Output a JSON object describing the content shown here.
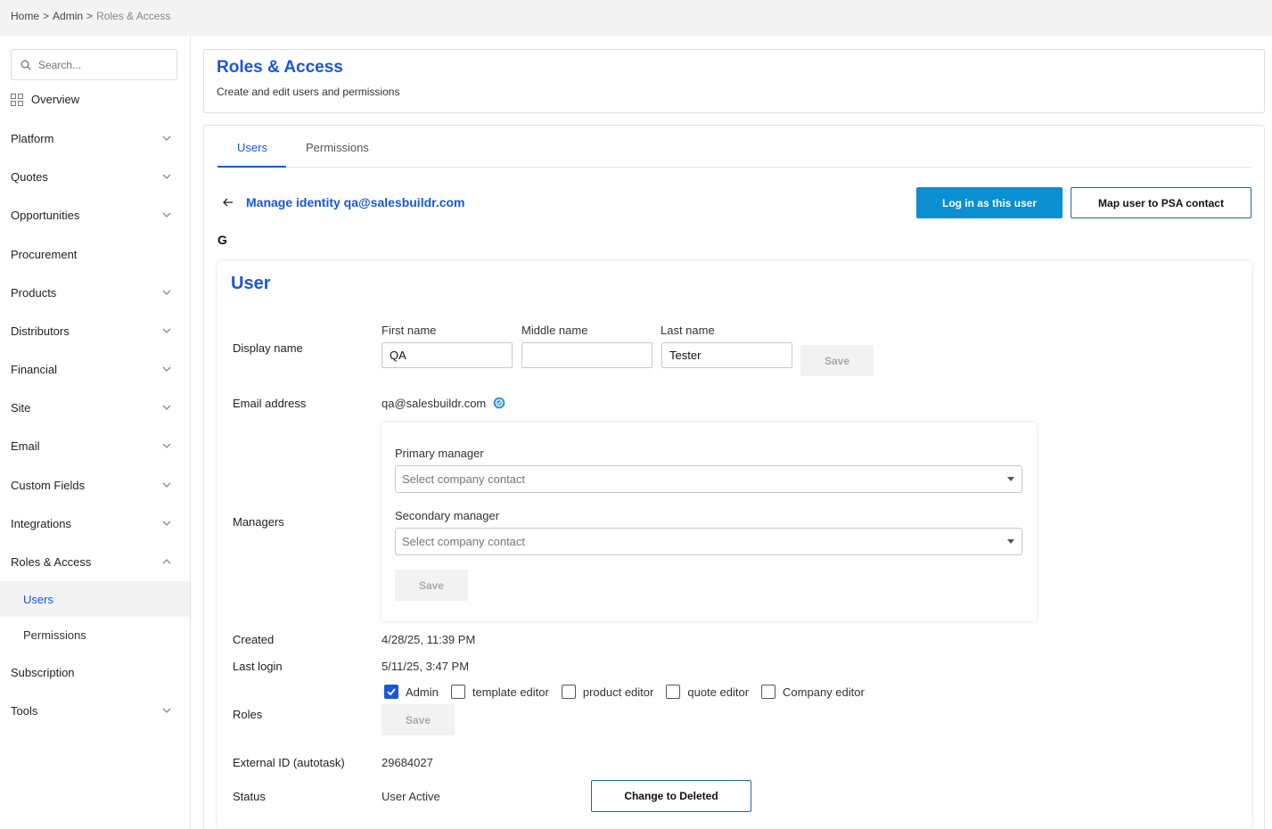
{
  "breadcrumb": {
    "home": "Home",
    "sep1": ">",
    "admin": "Admin",
    "sep2": ">",
    "current": "Roles & Access"
  },
  "sidebar": {
    "search_placeholder": "Search...",
    "overview": "Overview",
    "items": [
      {
        "label": "Platform"
      },
      {
        "label": "Quotes"
      },
      {
        "label": "Opportunities"
      },
      {
        "label": "Procurement"
      },
      {
        "label": "Products"
      },
      {
        "label": "Distributors"
      },
      {
        "label": "Financial"
      },
      {
        "label": "Site"
      },
      {
        "label": "Email"
      },
      {
        "label": "Custom Fields"
      },
      {
        "label": "Integrations"
      },
      {
        "label": "Roles & Access"
      },
      {
        "label": "Users"
      },
      {
        "label": "Permissions"
      },
      {
        "label": "Subscription"
      },
      {
        "label": "Tools"
      }
    ]
  },
  "header": {
    "title": "Roles & Access",
    "subtitle": "Create and edit users and permissions"
  },
  "tabs": {
    "users": "Users",
    "permissions": "Permissions"
  },
  "identity": {
    "title": "Manage identity qa@salesbuildr.com",
    "login_button": "Log in as this user",
    "map_button": "Map user to PSA contact",
    "provider_icon": "G"
  },
  "user": {
    "section_title": "User",
    "display_name_label": "Display name",
    "first_name_label": "First name",
    "middle_name_label": "Middle name",
    "last_name_label": "Last name",
    "first_name_value": "QA",
    "middle_name_value": "",
    "last_name_value": "Tester",
    "save_label": "Save",
    "email_label": "Email address",
    "email_value": "qa@salesbuildr.com",
    "managers_label": "Managers",
    "primary_manager_label": "Primary manager",
    "secondary_manager_label": "Secondary manager",
    "manager_placeholder": "Select company contact",
    "created_label": "Created",
    "created_value": "4/28/25, 11:39 PM",
    "last_login_label": "Last login",
    "last_login_value": "5/11/25, 3:47 PM",
    "roles_label": "Roles",
    "roles": [
      {
        "label": "Admin",
        "checked": true
      },
      {
        "label": "template editor",
        "checked": false
      },
      {
        "label": "product editor",
        "checked": false
      },
      {
        "label": "quote editor",
        "checked": false
      },
      {
        "label": "Company editor",
        "checked": false
      }
    ],
    "external_id_label": "External ID (autotask)",
    "external_id_value": "29684027",
    "status_label": "Status",
    "status_value": "User Active",
    "change_status_button": "Change to Deleted"
  },
  "colors": {
    "accent": "#1a56db",
    "primary_button": "#0a8fd0"
  }
}
